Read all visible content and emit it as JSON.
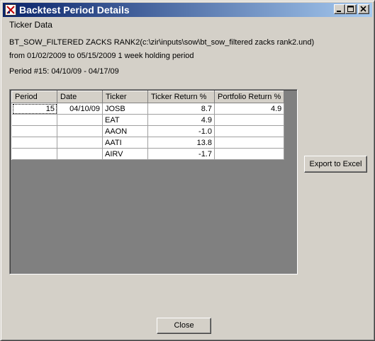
{
  "window": {
    "title": "Backtest Period Details",
    "section_title": "Ticker Data",
    "model_line": "BT_SOW_FILTERED ZACKS RANK2(c:\\zir\\inputs\\sow\\bt_sow_filtered zacks rank2.und)",
    "range_line": "from 01/02/2009 to 05/15/2009 1 week holding period",
    "period_line": "Period #15: 04/10/09 - 04/17/09"
  },
  "controls": {
    "minimize_icon": "minimize-icon",
    "maximize_icon": "maximize-icon",
    "close_icon": "close-icon",
    "app_icon": "app-icon"
  },
  "table": {
    "headers": [
      "Period",
      "Date",
      "Ticker",
      "Ticker Return %",
      "Portfolio Return %"
    ],
    "rows": [
      [
        "15",
        "04/10/09",
        "JOSB",
        "8.7",
        "4.9"
      ],
      [
        "",
        "",
        "EAT",
        "4.9",
        ""
      ],
      [
        "",
        "",
        "AAON",
        "-1.0",
        ""
      ],
      [
        "",
        "",
        "AATI",
        "13.8",
        ""
      ],
      [
        "",
        "",
        "AIRV",
        "-1.7",
        ""
      ]
    ]
  },
  "buttons": {
    "export": "Export to Excel",
    "close": "Close"
  }
}
